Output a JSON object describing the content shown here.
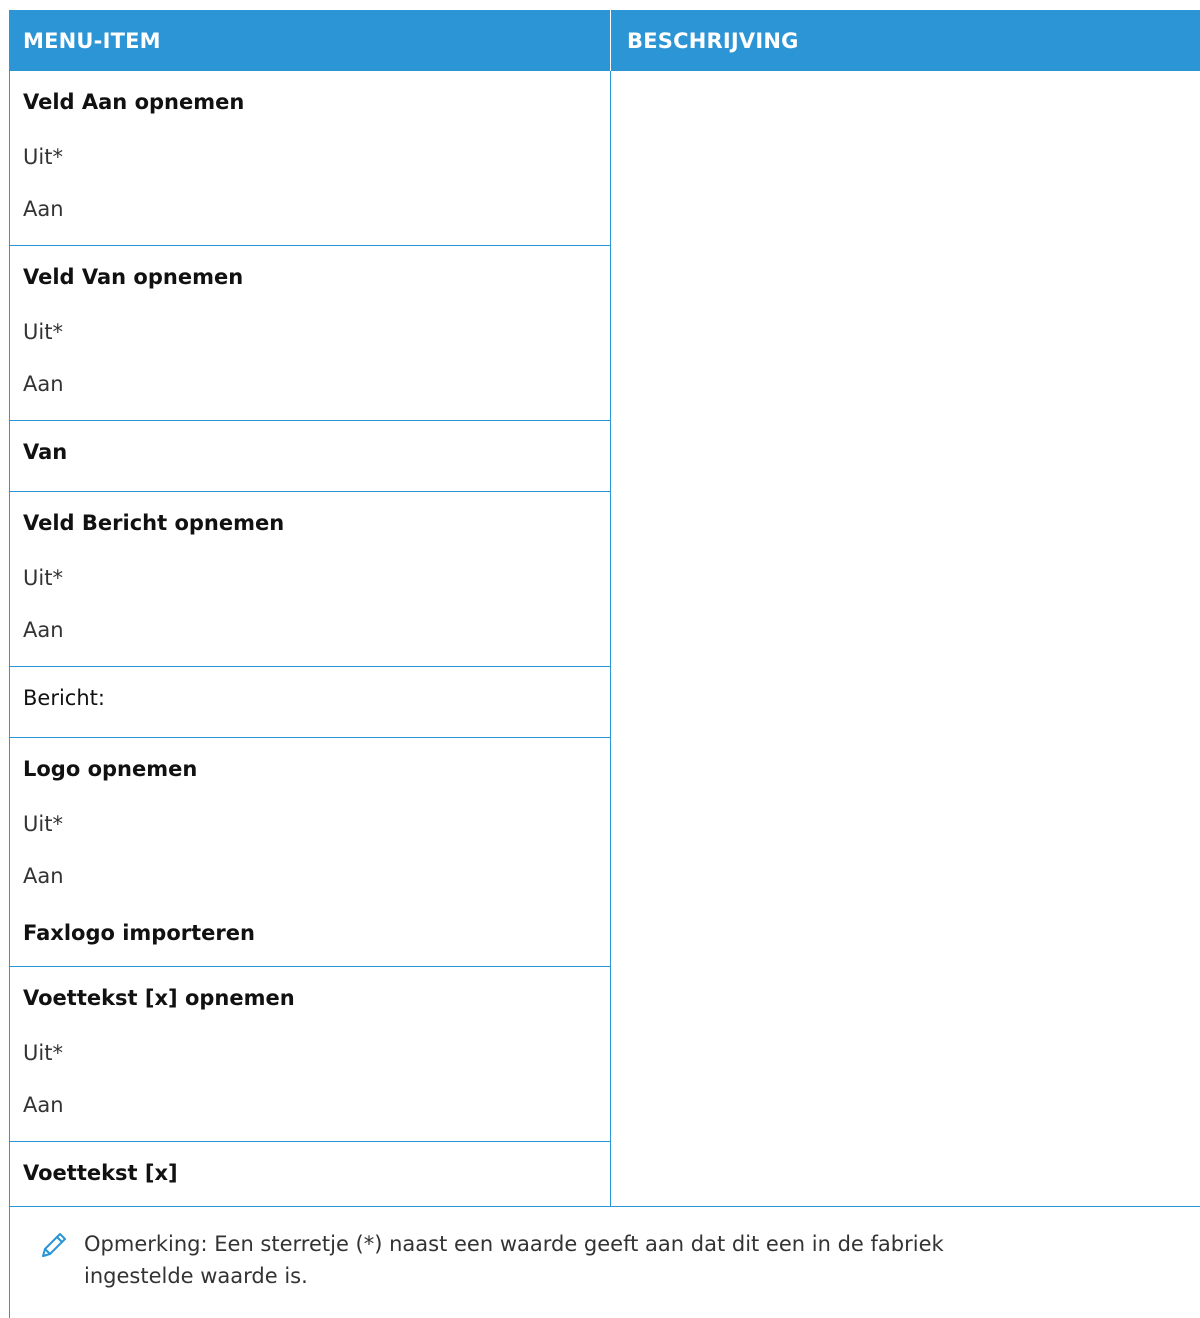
{
  "header": {
    "col1": "MENU-ITEM",
    "col2": "BESCHRIJVING"
  },
  "groups": [
    {
      "title": "Veld Aan opnemen",
      "options": [
        "Uit*",
        "Aan"
      ]
    },
    {
      "title": "Veld Van opnemen",
      "options": [
        "Uit*",
        "Aan"
      ]
    },
    {
      "title": "Van",
      "options": []
    },
    {
      "title": "Veld Bericht opnemen",
      "options": [
        "Uit*",
        "Aan"
      ]
    },
    {
      "title": "Bericht:",
      "options": []
    },
    {
      "title": "Logo opnemen",
      "options": [
        "Uit*",
        "Aan"
      ]
    },
    {
      "title": "Faxlogo importeren",
      "options": []
    },
    {
      "title": "Voettekst [x] opnemen",
      "options": [
        "Uit*",
        "Aan"
      ]
    },
    {
      "title": "Voettekst [x]",
      "options": []
    }
  ],
  "note": "Opmerking: Een sterretje (*) naast een waarde geeft aan dat dit een in de fabriek ingestelde waarde is.",
  "colors": {
    "accent": "#2b95d6",
    "header_text": "#ffffff"
  },
  "icons": {
    "note": "pencil-icon"
  }
}
